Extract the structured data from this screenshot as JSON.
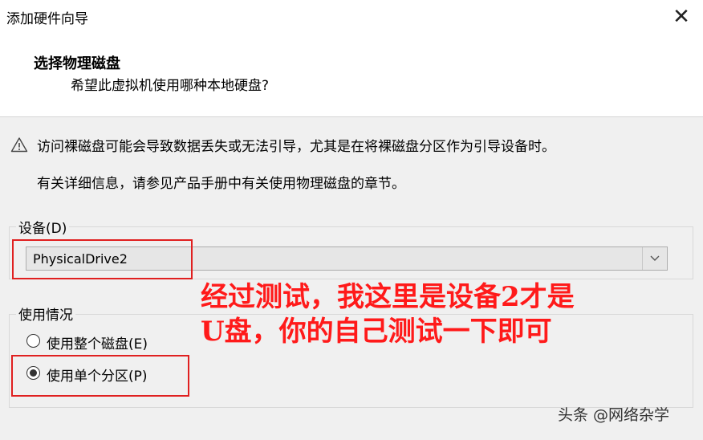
{
  "window": {
    "title": "添加硬件向导",
    "close_symbol": "✕"
  },
  "header": {
    "title": "选择物理磁盘",
    "subtitle": "希望此虚拟机使用哪种本地硬盘?"
  },
  "warning": {
    "text": "访问裸磁盘可能会导致数据丢失或无法引导，尤其是在将裸磁盘分区作为引导设备时。",
    "icon": "warning-triangle-icon"
  },
  "info": {
    "text": "有关详细信息，请参见产品手册中有关使用物理磁盘的章节。"
  },
  "device": {
    "label": "设备(D)",
    "selected": "PhysicalDrive2"
  },
  "usage": {
    "label": "使用情况",
    "options": [
      {
        "label": "使用整个磁盘(E)",
        "checked": false
      },
      {
        "label": "使用单个分区(P)",
        "checked": true
      }
    ]
  },
  "annotation": {
    "line1": "经过测试，我这里是设备2才是",
    "line2": "U盘，你的自己测试一下即可",
    "color": "#ff1a1a"
  },
  "watermark": {
    "text": "头条 @网络杂学"
  }
}
